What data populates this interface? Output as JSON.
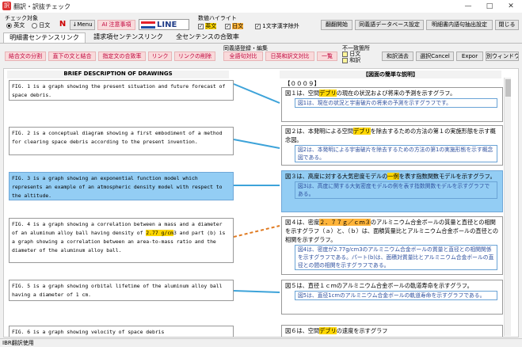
{
  "window": {
    "title": "翻訳・訳抜チェック"
  },
  "toolbar": {
    "check_target_label": "チェック対象",
    "english_label": "英文",
    "japanese_label": "日文",
    "menu_button": "↓Menu",
    "ai_button": "AI 注意事項",
    "logo_text": "LINE",
    "value_highlight_label": "数値ハイライト",
    "hl_english": "英文",
    "hl_japanese": "日文",
    "one_char_kanji": "1文字漢字除外",
    "btn_edit": "翻翻開始",
    "btn_db": "同義語データベース設定",
    "btn_extract": "明細書内語句抽出設定",
    "btn_close": "閉じる"
  },
  "tabs": [
    {
      "label": "明細書センテンスリンク"
    },
    {
      "label": "請求項センテンスリンク"
    },
    {
      "label": "全センテンスの合致率"
    }
  ],
  "actions": {
    "split": "結合文の分割",
    "merge": "直下の文と結合",
    "ratio": "指定文の合致率",
    "link": "リンク",
    "unlink": "リンクの削除",
    "synonym_label": "同義語登録・編集",
    "compare_all": "全語句対比",
    "compare_jp": "日英和訳文対比",
    "list": "一覧",
    "mismatch_label": "不一致箇所",
    "mismatch_jp": "日文",
    "mismatch_en": "和訳",
    "clear": "和訳消去",
    "cancel": "選択Cancel",
    "export": "Expor",
    "other_window": "別ウィンドウ"
  },
  "columns": {
    "left": "BRIEF DESCRIPTION OF DRAWINGS",
    "right": "【図面の簡単な説明】"
  },
  "para_number": "【０００９】",
  "rows": [
    {
      "en": "FIG. 1 is a graph showing the present situation and future forecast of space debris.",
      "jp": "図１は、空間デブリの現在の状況および将来の予測を示すグラフ。",
      "jp_sub": "図1は、現在の状況と宇宙破片の将来の予測を示すグラフです。"
    },
    {
      "en": "FIG. 2 is a conceptual diagram showing a first embodiment of a method for clearing space debris according to the present invention.",
      "jp": "図２は、本発明による空間デブリを除去するための方法の第１の実施形態を示す概念図。",
      "jp_sub": "図2は、本発明による宇宙破片を除去するための方法の第1の実施形態を示す概念図である。"
    },
    {
      "en": "FIG. 3 is a graph showing an exponential function model which represents an example of an atmospheric density model with respect to the altitude.",
      "jp": "図３は、高度に対する大気密度モデルの一例を表す指数関数モデルを示すグラフ。",
      "jp_sub": "図3は、高度に関する大気密度モデルの例を表す指数関数モデルを示すグラフである。"
    },
    {
      "en": "FIG. 4 is a graph showing a correlation between a mass and a diameter of an aluminum alloy ball having density of 2.77 g/cm3 and part (b) is a graph showing a correlation between an area-to-mass ratio and the diameter of the aluminum alloy ball.",
      "jp": "図４は、密度２．７７ｇ／ｃｍ３のアルミニウム合金ボールの質量と直径との相関を示すグラフ（ａ）と、（ｂ）は、面積質量比とアルミニウム合金ボールの直径との相関を示すグラフ。",
      "jp_sub": "図4は、密度が2.77g/cm3のアルミニウム合金ボールの質量と直径との相関関係を示すグラフである。パート(b)は、面積対質量比とアルミニウム合金ボールの直径との間の相関を示すグラフである。"
    },
    {
      "en": "FIG. 5 is a graph showing orbital lifetime of the aluminum alloy ball having a diameter of 1 cm.",
      "jp": "図５は、直径１ｃｍのアルミニウム合金ボールの軌道寿命を示すグラフ。",
      "jp_sub": "図5は、直径1cmのアルミニウム合金ボールの軌道寿命を示すグラフである。"
    },
    {
      "en": "FIG. 6 is a graph showing velocity of space debris",
      "jp": "図６は、空間デブリの速度を示すグラフ",
      "jp_sub": ""
    }
  ],
  "statusbar": {
    "text": "IBR翻訳使用"
  }
}
